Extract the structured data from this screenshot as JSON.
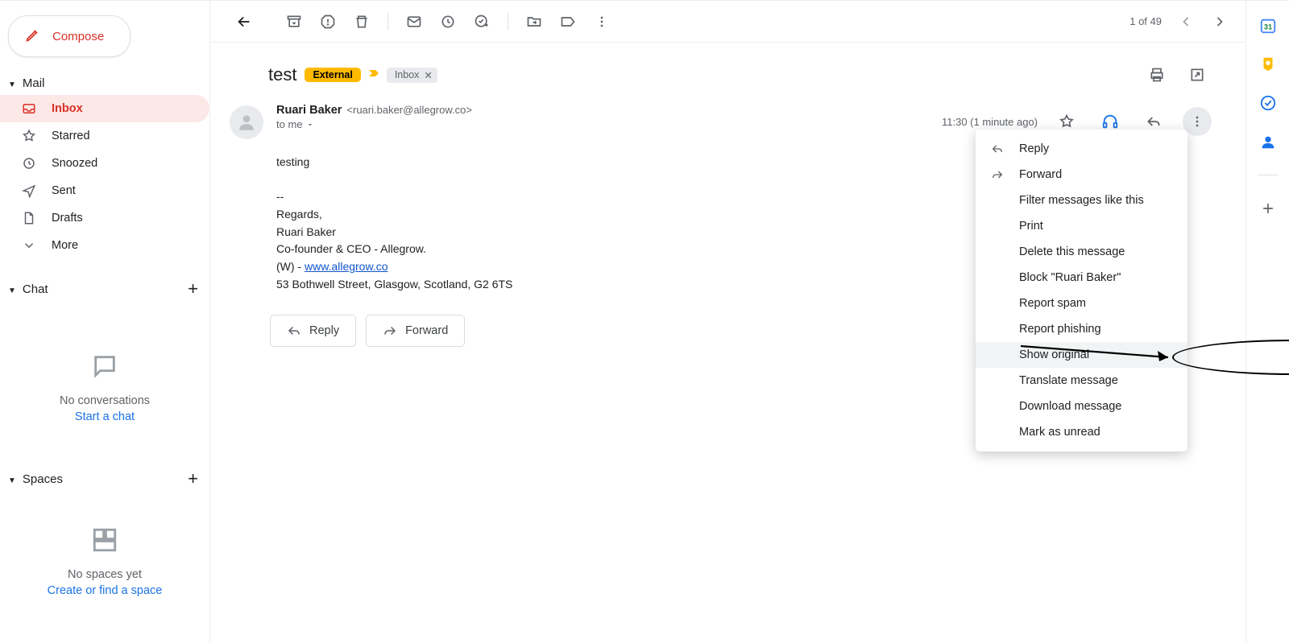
{
  "compose_label": "Compose",
  "sidebar": {
    "mail_header": "Mail",
    "chat_header": "Chat",
    "spaces_header": "Spaces",
    "items": [
      {
        "label": "Inbox"
      },
      {
        "label": "Starred"
      },
      {
        "label": "Snoozed"
      },
      {
        "label": "Sent"
      },
      {
        "label": "Drafts"
      },
      {
        "label": "More"
      }
    ],
    "chat_empty_text": "No conversations",
    "chat_start": "Start a chat",
    "spaces_empty_text": "No spaces yet",
    "spaces_create": "Create or find a space"
  },
  "pagination": {
    "text": "1 of 49"
  },
  "subject": {
    "title": "test",
    "external_label": "External",
    "inbox_chip": "Inbox"
  },
  "message": {
    "from_name": "Ruari Baker",
    "from_email": "<ruari.baker@allegrow.co>",
    "to_text": "to me",
    "time_text": "11:30 (1 minute ago)",
    "body_line1": "testing",
    "sig_dash": "--",
    "sig_regards": "Regards,",
    "sig_name": "Ruari Baker",
    "sig_title": "Co-founder & CEO - Allegrow.",
    "sig_w_prefix": "(W) - ",
    "sig_link": "www.allegrow.co",
    "sig_address": "53 Bothwell Street, Glasgow, Scotland, G2 6TS",
    "reply_label": "Reply",
    "forward_label": "Forward"
  },
  "menu": {
    "reply": "Reply",
    "forward": "Forward",
    "filter": "Filter messages like this",
    "print": "Print",
    "delete": "Delete this message",
    "block": "Block \"Ruari Baker\"",
    "spam": "Report spam",
    "phishing": "Report phishing",
    "show_original": "Show original",
    "translate": "Translate message",
    "download": "Download message",
    "mark_unread": "Mark as unread"
  }
}
